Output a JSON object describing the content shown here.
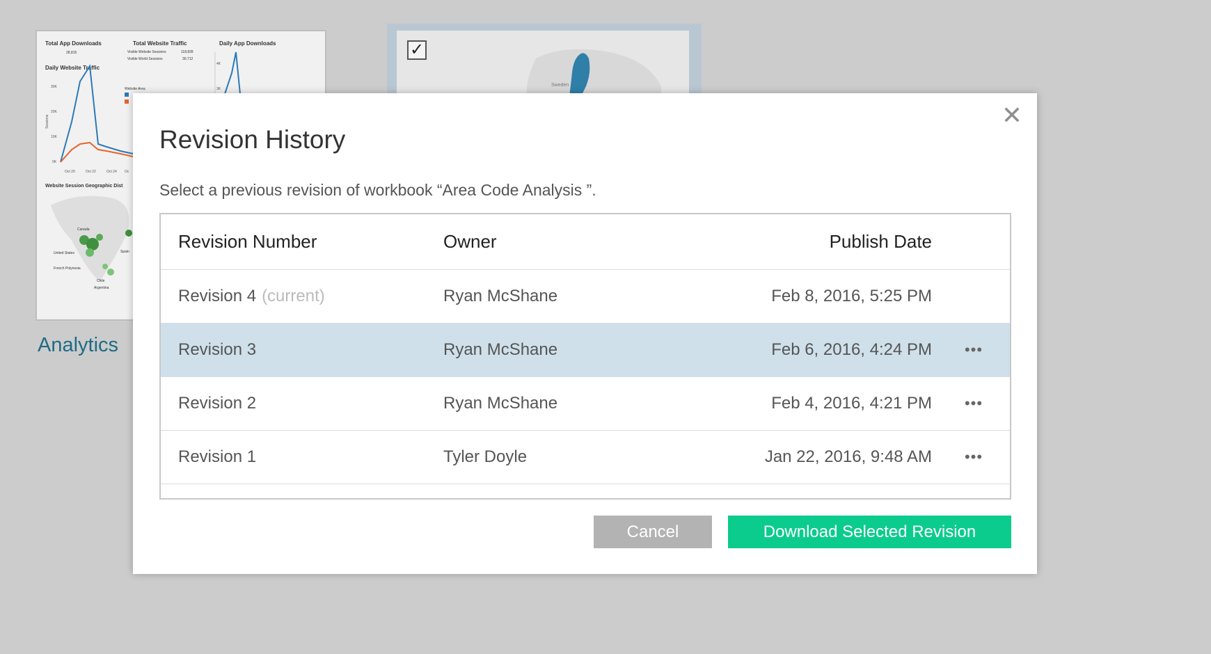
{
  "background": {
    "workbook_name": "Analytics",
    "thumbnail": {
      "total_app_downloads_label": "Total App Downloads",
      "total_app_downloads_value": "28,815",
      "total_website_traffic_label": "Total Website Traffic",
      "visible_website_sessions_label": "Visible Website Sessions",
      "visible_website_sessions_value": "118,828",
      "visible_world_sessions_label": "Visible World Sessions",
      "visible_world_sessions_value": "30,712",
      "daily_app_downloads_label": "Daily App Downloads",
      "daily_website_traffic_label": "Daily Website Traffic",
      "website_area_label": "Website Area",
      "geo_label": "Website Session Geographic Dist",
      "y_ticks": [
        "30K",
        "20K",
        "10K",
        "0K"
      ],
      "x_ticks": [
        "Oct 20",
        "Oct 22",
        "Oct 24",
        "Oc"
      ],
      "right_ticks": [
        "4K",
        "3K"
      ],
      "sessions_label": "Sessions",
      "map_labels": [
        "Canada",
        "United States",
        "French Polynesia",
        "Chile",
        "Argentina",
        "Spain"
      ]
    },
    "thumbnail2": {
      "map_label": "Sweden"
    }
  },
  "modal": {
    "title": "Revision History",
    "subtitle": "Select a previous revision of workbook “Area Code Analysis ”.",
    "close_symbol": "✕",
    "columns": {
      "revision": "Revision Number",
      "owner": "Owner",
      "date": "Publish Date"
    },
    "rows": [
      {
        "revision": "Revision 4",
        "tag": "(current)",
        "owner": "Ryan McShane",
        "date": "Feb 8, 2016, 5:25 PM",
        "more": ""
      },
      {
        "revision": "Revision 3",
        "tag": "",
        "owner": "Ryan McShane",
        "date": "Feb 6, 2016, 4:24 PM",
        "more": "•••"
      },
      {
        "revision": "Revision 2",
        "tag": "",
        "owner": "Ryan McShane",
        "date": "Feb 4, 2016, 4:21 PM",
        "more": "•••"
      },
      {
        "revision": "Revision 1",
        "tag": "",
        "owner": "Tyler Doyle",
        "date": "Jan 22, 2016, 9:48 AM",
        "more": "•••"
      }
    ],
    "cancel_label": "Cancel",
    "download_label": "Download Selected Revision"
  },
  "colors": {
    "accent_green": "#0bcc8c",
    "selected_row": "#cfe0ea",
    "link_blue": "#1f6b85"
  }
}
